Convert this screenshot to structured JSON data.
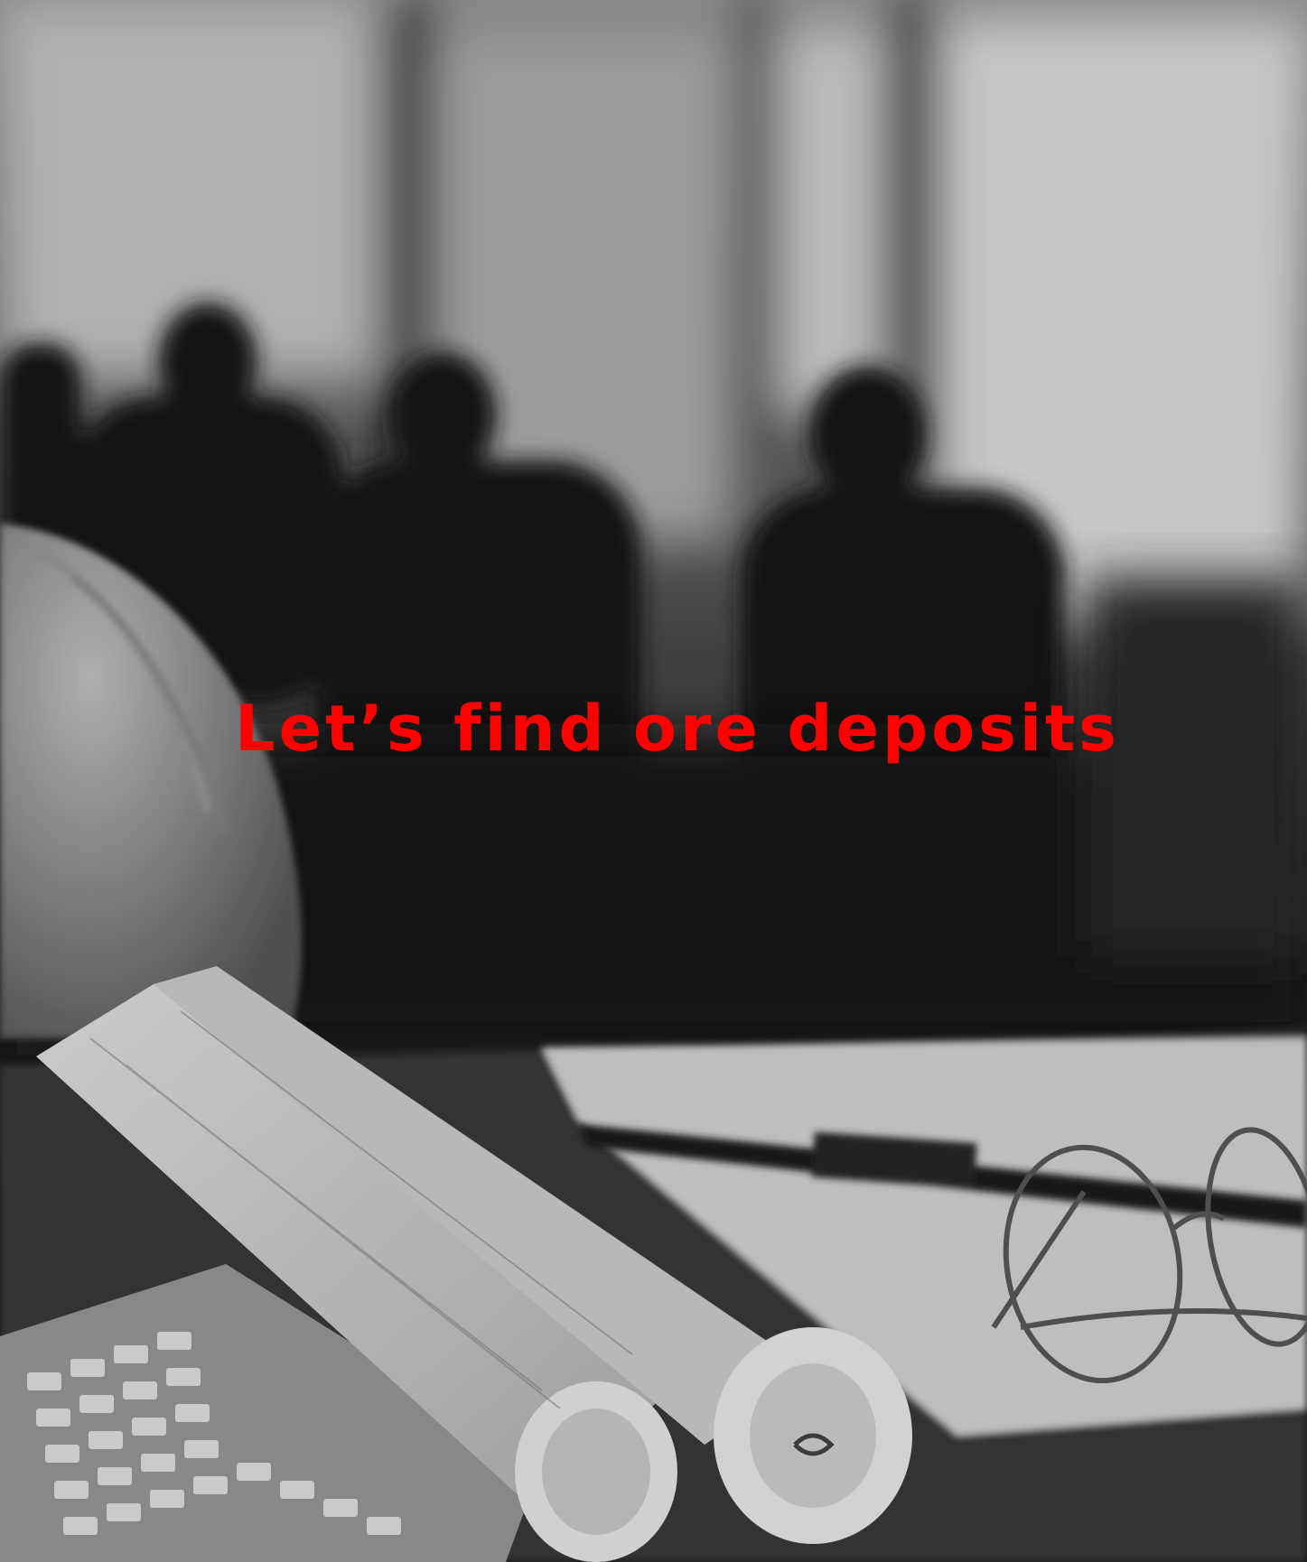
{
  "hero": {
    "title": "Let’s find ore deposits",
    "title_color": "#ff0000",
    "image_subject": "blurred grayscale office photo with hard hat, rolled blueprints, keyboard and eyeglasses"
  }
}
